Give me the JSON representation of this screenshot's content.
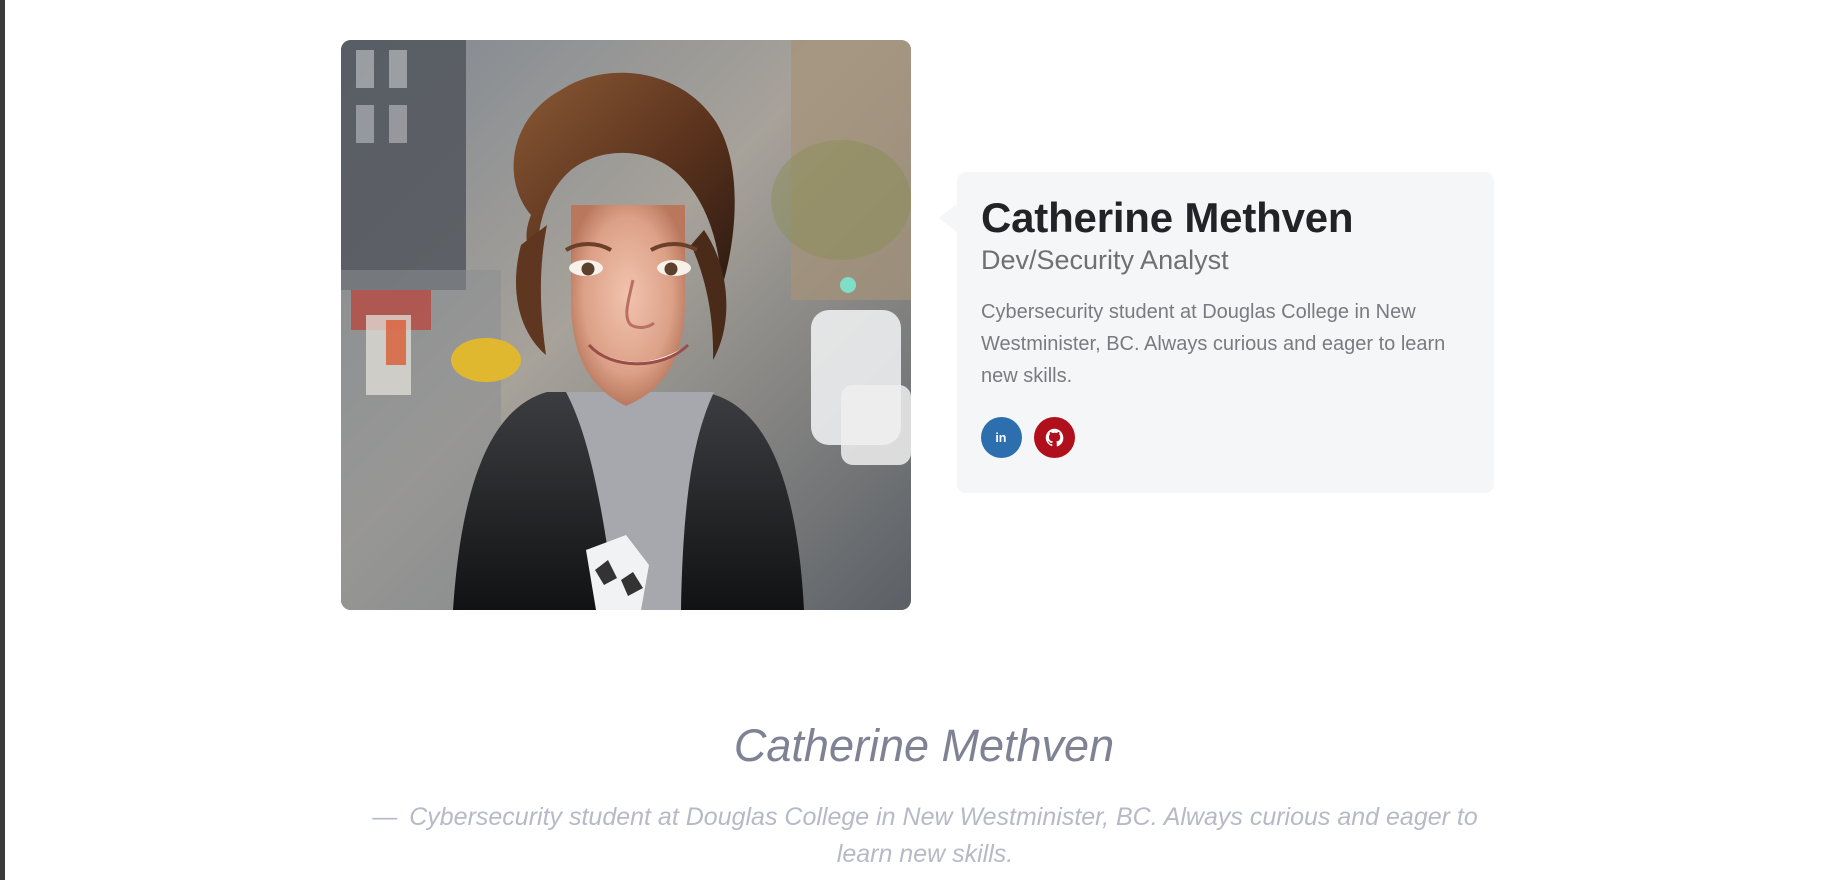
{
  "profile": {
    "name": "Catherine Methven",
    "role": "Dev/Security Analyst",
    "bio": "Cybersecurity student at Douglas College in New Westminister, BC. Always curious and eager to learn new skills.",
    "photo_alt": "Catherine Methven"
  },
  "social": [
    {
      "name": "linkedin",
      "icon": "linkedin-icon",
      "label": "in",
      "color": "#2d6fae"
    },
    {
      "name": "github",
      "icon": "github-icon",
      "color": "#b00f1c"
    }
  ],
  "quote": {
    "author": "Catherine Methven",
    "dash": "—",
    "text": "Cybersecurity student at Douglas College in New Westminister, BC. Always curious and eager to learn new skills."
  },
  "colors": {
    "card_bg": "#f5f6f8",
    "linkedin": "#2d6fae",
    "github": "#b00f1c",
    "quote_name": "#7e8294",
    "quote_text": "#b7b9c6"
  }
}
